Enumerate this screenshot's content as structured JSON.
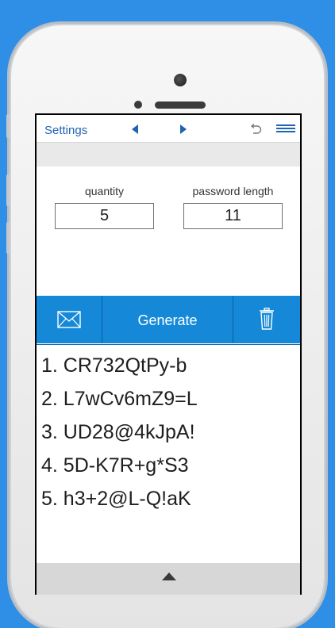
{
  "nav": {
    "settings_label": "Settings",
    "icons": [
      "prev-arrow-icon",
      "next-arrow-icon",
      "undo-icon",
      "menu-icon"
    ]
  },
  "fields": {
    "quantity": {
      "label": "quantity",
      "value": "5"
    },
    "password_length": {
      "label": "password length",
      "value": "11"
    }
  },
  "toolbar": {
    "email_icon": "envelope-icon",
    "generate_label": "Generate",
    "delete_icon": "trash-icon"
  },
  "results": [
    {
      "text": "1. CR732QtPy-b"
    },
    {
      "text": "2. L7wCv6mZ9=L"
    },
    {
      "text": "3. UD28@4kJpA!"
    },
    {
      "text": "4. 5D-K7R+g*S3"
    },
    {
      "text": "5. h3+2@L-Q!aK"
    }
  ],
  "footer": {
    "icon": "expand-up-icon"
  },
  "colors": {
    "background": "#2f8ee6",
    "accent": "#1589d7",
    "link": "#1f63b3"
  }
}
